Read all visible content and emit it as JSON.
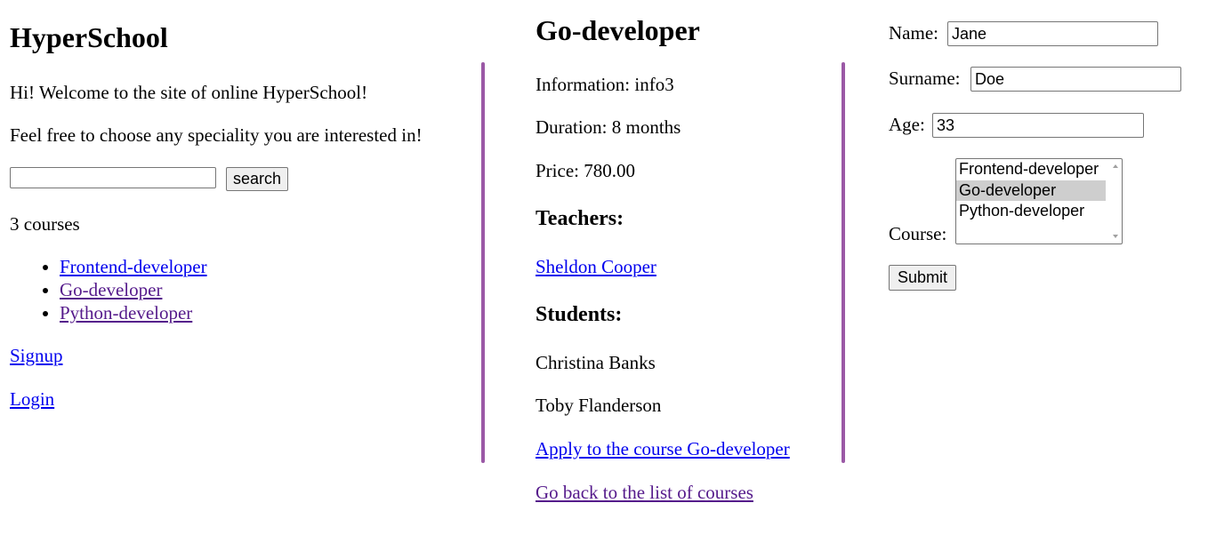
{
  "left": {
    "title": "HyperSchool",
    "welcome": "Hi! Welcome to the site of online HyperSchool!",
    "choose": "Feel free to choose any speciality you are interested in!",
    "search_placeholder": "",
    "search_button": "search",
    "course_count": "3 courses",
    "courses": [
      "Frontend-developer",
      "Go-developer",
      "Python-developer"
    ],
    "signup": "Signup",
    "login": "Login"
  },
  "course": {
    "title": "Go-developer",
    "information": "Information: info3",
    "duration": "Duration: 8 months",
    "price": "Price: 780.00",
    "teachers_heading": "Teachers:",
    "teachers": [
      "Sheldon Cooper"
    ],
    "students_heading": "Students:",
    "students": [
      "Christina Banks",
      "Toby Flanderson"
    ],
    "apply_link": "Apply to the course Go-developer",
    "back_link": "Go back to the list of courses"
  },
  "form": {
    "name_label": "Name:",
    "name_value": "Jane",
    "surname_label": "Surname:",
    "surname_value": "Doe",
    "age_label": "Age:",
    "age_value": "33",
    "course_label": "Course:",
    "course_options": [
      "Frontend-developer",
      "Go-developer",
      "Python-developer"
    ],
    "course_selected": "Go-developer",
    "submit": "Submit"
  },
  "colors": {
    "divider": "#9b59a6",
    "link": "#0000ee",
    "visited_link": "#551a8b"
  }
}
